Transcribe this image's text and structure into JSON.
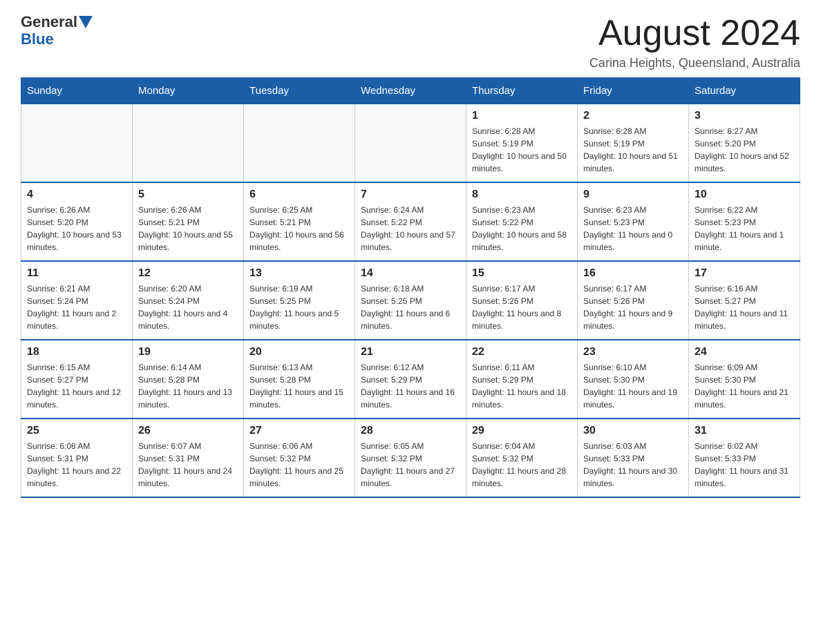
{
  "header": {
    "logo_general": "General",
    "logo_blue": "Blue",
    "title": "August 2024",
    "subtitle": "Carina Heights, Queensland, Australia"
  },
  "days_of_week": [
    "Sunday",
    "Monday",
    "Tuesday",
    "Wednesday",
    "Thursday",
    "Friday",
    "Saturday"
  ],
  "weeks": [
    [
      {
        "day": "",
        "sunrise": "",
        "sunset": "",
        "daylight": ""
      },
      {
        "day": "",
        "sunrise": "",
        "sunset": "",
        "daylight": ""
      },
      {
        "day": "",
        "sunrise": "",
        "sunset": "",
        "daylight": ""
      },
      {
        "day": "",
        "sunrise": "",
        "sunset": "",
        "daylight": ""
      },
      {
        "day": "1",
        "sunrise": "Sunrise: 6:28 AM",
        "sunset": "Sunset: 5:19 PM",
        "daylight": "Daylight: 10 hours and 50 minutes."
      },
      {
        "day": "2",
        "sunrise": "Sunrise: 6:28 AM",
        "sunset": "Sunset: 5:19 PM",
        "daylight": "Daylight: 10 hours and 51 minutes."
      },
      {
        "day": "3",
        "sunrise": "Sunrise: 6:27 AM",
        "sunset": "Sunset: 5:20 PM",
        "daylight": "Daylight: 10 hours and 52 minutes."
      }
    ],
    [
      {
        "day": "4",
        "sunrise": "Sunrise: 6:26 AM",
        "sunset": "Sunset: 5:20 PM",
        "daylight": "Daylight: 10 hours and 53 minutes."
      },
      {
        "day": "5",
        "sunrise": "Sunrise: 6:26 AM",
        "sunset": "Sunset: 5:21 PM",
        "daylight": "Daylight: 10 hours and 55 minutes."
      },
      {
        "day": "6",
        "sunrise": "Sunrise: 6:25 AM",
        "sunset": "Sunset: 5:21 PM",
        "daylight": "Daylight: 10 hours and 56 minutes."
      },
      {
        "day": "7",
        "sunrise": "Sunrise: 6:24 AM",
        "sunset": "Sunset: 5:22 PM",
        "daylight": "Daylight: 10 hours and 57 minutes."
      },
      {
        "day": "8",
        "sunrise": "Sunrise: 6:23 AM",
        "sunset": "Sunset: 5:22 PM",
        "daylight": "Daylight: 10 hours and 58 minutes."
      },
      {
        "day": "9",
        "sunrise": "Sunrise: 6:23 AM",
        "sunset": "Sunset: 5:23 PM",
        "daylight": "Daylight: 11 hours and 0 minutes."
      },
      {
        "day": "10",
        "sunrise": "Sunrise: 6:22 AM",
        "sunset": "Sunset: 5:23 PM",
        "daylight": "Daylight: 11 hours and 1 minute."
      }
    ],
    [
      {
        "day": "11",
        "sunrise": "Sunrise: 6:21 AM",
        "sunset": "Sunset: 5:24 PM",
        "daylight": "Daylight: 11 hours and 2 minutes."
      },
      {
        "day": "12",
        "sunrise": "Sunrise: 6:20 AM",
        "sunset": "Sunset: 5:24 PM",
        "daylight": "Daylight: 11 hours and 4 minutes."
      },
      {
        "day": "13",
        "sunrise": "Sunrise: 6:19 AM",
        "sunset": "Sunset: 5:25 PM",
        "daylight": "Daylight: 11 hours and 5 minutes."
      },
      {
        "day": "14",
        "sunrise": "Sunrise: 6:18 AM",
        "sunset": "Sunset: 5:25 PM",
        "daylight": "Daylight: 11 hours and 6 minutes."
      },
      {
        "day": "15",
        "sunrise": "Sunrise: 6:17 AM",
        "sunset": "Sunset: 5:26 PM",
        "daylight": "Daylight: 11 hours and 8 minutes."
      },
      {
        "day": "16",
        "sunrise": "Sunrise: 6:17 AM",
        "sunset": "Sunset: 5:26 PM",
        "daylight": "Daylight: 11 hours and 9 minutes."
      },
      {
        "day": "17",
        "sunrise": "Sunrise: 6:16 AM",
        "sunset": "Sunset: 5:27 PM",
        "daylight": "Daylight: 11 hours and 11 minutes."
      }
    ],
    [
      {
        "day": "18",
        "sunrise": "Sunrise: 6:15 AM",
        "sunset": "Sunset: 5:27 PM",
        "daylight": "Daylight: 11 hours and 12 minutes."
      },
      {
        "day": "19",
        "sunrise": "Sunrise: 6:14 AM",
        "sunset": "Sunset: 5:28 PM",
        "daylight": "Daylight: 11 hours and 13 minutes."
      },
      {
        "day": "20",
        "sunrise": "Sunrise: 6:13 AM",
        "sunset": "Sunset: 5:28 PM",
        "daylight": "Daylight: 11 hours and 15 minutes."
      },
      {
        "day": "21",
        "sunrise": "Sunrise: 6:12 AM",
        "sunset": "Sunset: 5:29 PM",
        "daylight": "Daylight: 11 hours and 16 minutes."
      },
      {
        "day": "22",
        "sunrise": "Sunrise: 6:11 AM",
        "sunset": "Sunset: 5:29 PM",
        "daylight": "Daylight: 11 hours and 18 minutes."
      },
      {
        "day": "23",
        "sunrise": "Sunrise: 6:10 AM",
        "sunset": "Sunset: 5:30 PM",
        "daylight": "Daylight: 11 hours and 19 minutes."
      },
      {
        "day": "24",
        "sunrise": "Sunrise: 6:09 AM",
        "sunset": "Sunset: 5:30 PM",
        "daylight": "Daylight: 11 hours and 21 minutes."
      }
    ],
    [
      {
        "day": "25",
        "sunrise": "Sunrise: 6:08 AM",
        "sunset": "Sunset: 5:31 PM",
        "daylight": "Daylight: 11 hours and 22 minutes."
      },
      {
        "day": "26",
        "sunrise": "Sunrise: 6:07 AM",
        "sunset": "Sunset: 5:31 PM",
        "daylight": "Daylight: 11 hours and 24 minutes."
      },
      {
        "day": "27",
        "sunrise": "Sunrise: 6:06 AM",
        "sunset": "Sunset: 5:32 PM",
        "daylight": "Daylight: 11 hours and 25 minutes."
      },
      {
        "day": "28",
        "sunrise": "Sunrise: 6:05 AM",
        "sunset": "Sunset: 5:32 PM",
        "daylight": "Daylight: 11 hours and 27 minutes."
      },
      {
        "day": "29",
        "sunrise": "Sunrise: 6:04 AM",
        "sunset": "Sunset: 5:32 PM",
        "daylight": "Daylight: 11 hours and 28 minutes."
      },
      {
        "day": "30",
        "sunrise": "Sunrise: 6:03 AM",
        "sunset": "Sunset: 5:33 PM",
        "daylight": "Daylight: 11 hours and 30 minutes."
      },
      {
        "day": "31",
        "sunrise": "Sunrise: 6:02 AM",
        "sunset": "Sunset: 5:33 PM",
        "daylight": "Daylight: 11 hours and 31 minutes."
      }
    ]
  ]
}
